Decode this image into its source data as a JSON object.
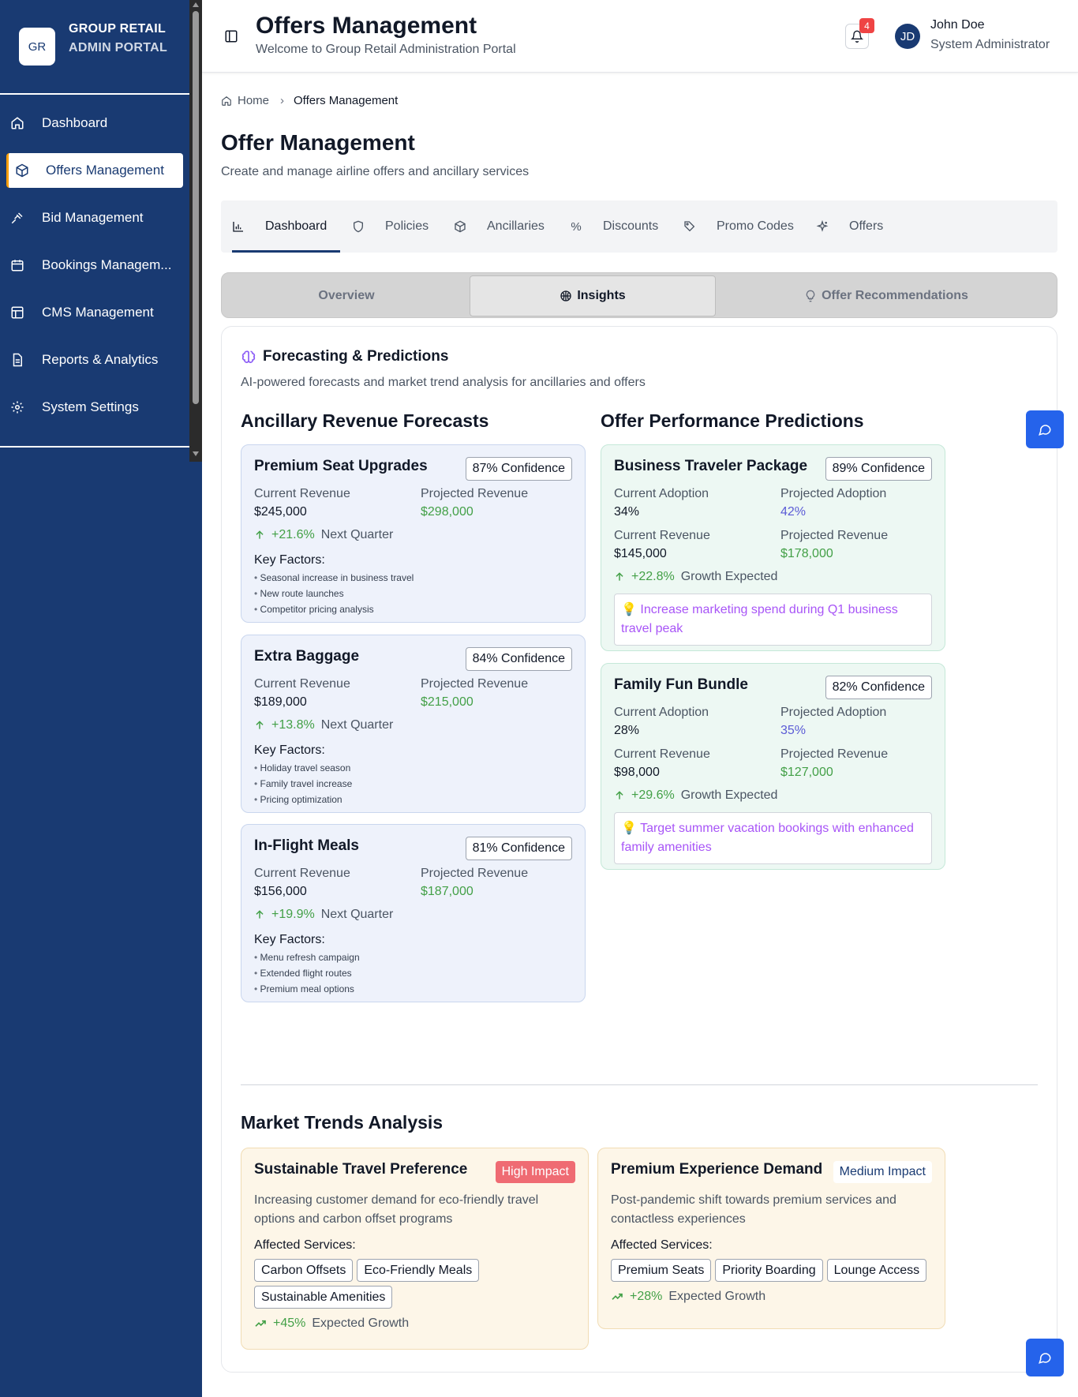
{
  "sidebar": {
    "logo": "GR",
    "brand_line1": "GROUP RETAIL",
    "brand_line2": "ADMIN PORTAL",
    "items": [
      {
        "label": "Dashboard",
        "icon": "home-icon"
      },
      {
        "label": "Offers Management",
        "icon": "package-icon"
      },
      {
        "label": "Bid Management",
        "icon": "gavel-icon"
      },
      {
        "label": "Bookings Managem...",
        "icon": "calendar-icon"
      },
      {
        "label": "CMS Management",
        "icon": "layout-icon"
      },
      {
        "label": "Reports & Analytics",
        "icon": "file-icon"
      },
      {
        "label": "System Settings",
        "icon": "gear-icon"
      }
    ]
  },
  "header": {
    "title": "Offers Management",
    "subtitle": "Welcome to Group Retail Administration Portal",
    "notification_count": "4",
    "avatar": "JD",
    "user_name": "John Doe",
    "user_role": "System Administrator"
  },
  "breadcrumb": {
    "home": "Home",
    "current": "Offers Management"
  },
  "page": {
    "title": "Offer Management",
    "subtitle": "Create and manage airline offers and ancillary services"
  },
  "tabs": [
    {
      "label": "Dashboard",
      "icon": "bar-chart-icon"
    },
    {
      "label": "Policies",
      "icon": "shield-icon"
    },
    {
      "label": "Ancillaries",
      "icon": "package-icon"
    },
    {
      "label": "Discounts",
      "icon": "percent-icon"
    },
    {
      "label": "Promo Codes",
      "icon": "tag-icon"
    },
    {
      "label": "Offers",
      "icon": "sparkles-icon"
    }
  ],
  "segments": [
    {
      "label": "Overview"
    },
    {
      "label": "Insights",
      "icon": "brain-icon"
    },
    {
      "label": "Offer Recommendations",
      "icon": "lightbulb-icon"
    }
  ],
  "panel": {
    "title": "Forecasting & Predictions",
    "subtitle": "AI-powered forecasts and market trend analysis for ancillaries and offers"
  },
  "forecasts": {
    "heading": "Ancillary Revenue Forecasts",
    "current_label": "Current Revenue",
    "projected_label": "Projected Revenue",
    "period_label": "Next Quarter",
    "factors_label": "Key Factors:",
    "cards": [
      {
        "title": "Premium Seat Upgrades",
        "confidence": "87% Confidence",
        "current": "$245,000",
        "projected": "$298,000",
        "growth": "+21.6%",
        "factors": [
          "Seasonal increase in business travel",
          "New route launches",
          "Competitor pricing analysis"
        ]
      },
      {
        "title": "Extra Baggage",
        "confidence": "84% Confidence",
        "current": "$189,000",
        "projected": "$215,000",
        "growth": "+13.8%",
        "factors": [
          "Holiday travel season",
          "Family travel increase",
          "Pricing optimization"
        ]
      },
      {
        "title": "In-Flight Meals",
        "confidence": "81% Confidence",
        "current": "$156,000",
        "projected": "$187,000",
        "growth": "+19.9%",
        "factors": [
          "Menu refresh campaign",
          "Extended flight routes",
          "Premium meal options"
        ]
      }
    ]
  },
  "predictions": {
    "heading": "Offer Performance Predictions",
    "cur_adopt_label": "Current Adoption",
    "proj_adopt_label": "Projected Adoption",
    "cur_rev_label": "Current Revenue",
    "proj_rev_label": "Projected Revenue",
    "growth_label": "Growth Expected",
    "cards": [
      {
        "title": "Business Traveler Package",
        "confidence": "89% Confidence",
        "cur_adopt": "34%",
        "proj_adopt": "42%",
        "cur_rev": "$145,000",
        "proj_rev": "$178,000",
        "growth": "+22.8%",
        "tip": "💡 Increase marketing spend during Q1 business travel peak"
      },
      {
        "title": "Family Fun Bundle",
        "confidence": "82% Confidence",
        "cur_adopt": "28%",
        "proj_adopt": "35%",
        "cur_rev": "$98,000",
        "proj_rev": "$127,000",
        "growth": "+29.6%",
        "tip": "💡 Target summer vacation bookings with enhanced family amenities"
      }
    ]
  },
  "trends": {
    "heading": "Market Trends Analysis",
    "affected_label": "Affected Services:",
    "growth_label": "Expected Growth",
    "cards": [
      {
        "title": "Sustainable Travel Preference",
        "impact": "High Impact",
        "desc": "Increasing customer demand for eco-friendly travel options and carbon offset programs",
        "services": [
          "Carbon Offsets",
          "Eco-Friendly Meals",
          "Sustainable Amenities"
        ],
        "growth": "+45%"
      },
      {
        "title": "Premium Experience Demand",
        "impact": "Medium Impact",
        "desc": "Post-pandemic shift towards premium services and contactless experiences",
        "services": [
          "Premium Seats",
          "Priority Boarding",
          "Lounge Access"
        ],
        "growth": "+28%"
      }
    ]
  },
  "colors": {
    "sidebar": "#193a72",
    "accent": "#2563eb",
    "positive": "#43a047",
    "tip": "#a855f7",
    "high_impact": "#ef6b73"
  }
}
